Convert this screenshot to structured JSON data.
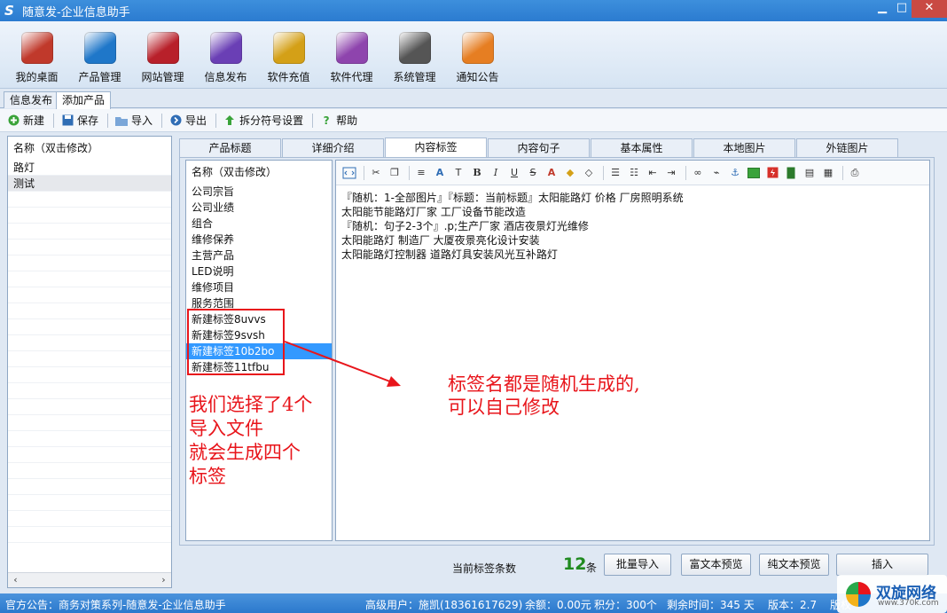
{
  "window": {
    "title": "随意发-企业信息助手",
    "logo_letter": "S",
    "minimize": "▁",
    "maximize": "□",
    "close": "✕"
  },
  "main_toolbar": [
    {
      "label": "我的桌面",
      "icon": "home-icon",
      "color": "#c0392b"
    },
    {
      "label": "产品管理",
      "icon": "cloud-icon",
      "color": "#1f77c9"
    },
    {
      "label": "网站管理",
      "icon": "server-icon",
      "color": "#b8202a"
    },
    {
      "label": "信息发布",
      "icon": "magic-wand-icon",
      "color": "#6a3fb5"
    },
    {
      "label": "软件充值",
      "icon": "coins-icon",
      "color": "#d4a017"
    },
    {
      "label": "软件代理",
      "icon": "gift-icon",
      "color": "#8e44ad"
    },
    {
      "label": "系统管理",
      "icon": "gear-icon",
      "color": "#555555"
    },
    {
      "label": "通知公告",
      "icon": "document-icon",
      "color": "#e67e22"
    }
  ],
  "page_tabs": [
    {
      "label": "信息发布"
    },
    {
      "label": "添加产品"
    }
  ],
  "sub_toolbar": {
    "new": "新建",
    "save": "保存",
    "import": "导入",
    "export": "导出",
    "split": "拆分符号设置",
    "help": "帮助"
  },
  "product_list": {
    "header": "名称（双击修改）",
    "items": [
      "路灯",
      "测试"
    ]
  },
  "content_tabs": [
    "产品标题",
    "详细介绍",
    "内容标签",
    "内容句子",
    "基本属性",
    "本地图片",
    "外链图片"
  ],
  "tag_list": {
    "header": "名称（双击修改）",
    "items": [
      "公司宗旨",
      "公司业绩",
      "组合",
      "维修保养",
      "主营产品",
      "LED说明",
      "维修项目",
      "服务范围",
      "新建标签8uvvs",
      "新建标签9svsh",
      "新建标签10b2bo",
      "新建标签11tfbu"
    ],
    "selected_index": 10
  },
  "editor": {
    "lines": [
      "『随机：1-全部图片』『标题：当前标题』太阳能路灯 价格 厂房照明系统",
      "太阳能节能路灯厂家 工厂设备节能改造",
      "『随机：句子2-3个』.p;生产厂家 酒店夜景灯光维修",
      "太阳能路灯 制造厂 大厦夜景亮化设计安装",
      "太阳能路灯控制器 道路灯具安装风光互补路灯"
    ]
  },
  "annotations": {
    "left_note": [
      "我们选择了4个",
      "导入文件",
      "就会生成四个",
      "标签"
    ],
    "right_note": [
      "标签名都是随机生成的,",
      "可以自己修改"
    ],
    "color": "#e8151b"
  },
  "bottom": {
    "count_label": "当前标签条数",
    "count": "12",
    "count_unit": "条",
    "btn_batch_import": "批量导入",
    "btn_rich_preview": "富文本预览",
    "btn_plain_preview": "纯文本预览",
    "btn_insert": "插入"
  },
  "status": {
    "notice": "官方公告：商务对策系列-随意发-企业信息助手",
    "user": "高级用户：施凯(18361617629)",
    "balance": "余额：0.00元",
    "points": "积分：300个",
    "remaining": "剩余时间：345 天",
    "version": "版本：2.7",
    "tail": "版权"
  },
  "watermark": {
    "name": "双旋网络",
    "site": "www.370k.com"
  }
}
